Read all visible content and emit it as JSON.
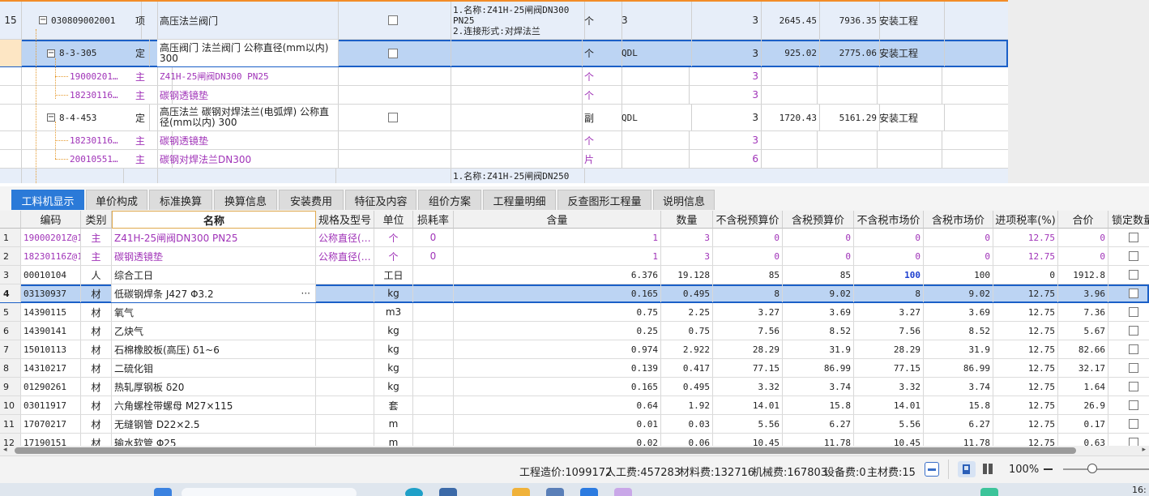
{
  "top_rows": [
    {
      "row_no": "15",
      "code": "030809002001",
      "type": "项",
      "name": "高压法兰阀门",
      "feature": "1.名称:Z41H-25闸阀DN300 PN25\n2.连接形式:对焊法兰",
      "unit": "个",
      "formula": "3",
      "qty": "3",
      "price": "2645.45",
      "total": "7936.35",
      "category": "安装工程"
    },
    {
      "row_no": "",
      "code": "8-3-305",
      "type": "定",
      "name": "高压阀门 法兰阀门 公称直径(mm以内) 300",
      "feature": "",
      "unit": "个",
      "formula": "QDL",
      "qty": "3",
      "price": "925.02",
      "total": "2775.06",
      "category": "安装工程"
    },
    {
      "code": "19000201…",
      "type": "主",
      "name": "Z41H-25闸阀DN300 PN25",
      "unit": "个",
      "qty": "3"
    },
    {
      "code": "18230116…",
      "type": "主",
      "name": "碳钢透镜垫",
      "unit": "个",
      "qty": "3"
    },
    {
      "code": "8-4-453",
      "type": "定",
      "name": "高压法兰 碳钢对焊法兰(电弧焊) 公称直径(mm以内) 300",
      "unit": "副",
      "formula": "QDL",
      "qty": "3",
      "price": "1720.43",
      "total": "5161.29",
      "category": "安装工程"
    },
    {
      "code": "18230116…",
      "type": "主",
      "name": "碳钢透镜垫",
      "unit": "个",
      "qty": "3"
    },
    {
      "code": "20010551…",
      "type": "主",
      "name": "碳钢对焊法兰DN300",
      "unit": "片",
      "qty": "6"
    },
    {
      "feature": "1.名称:Z41H-25闸阀DN250"
    }
  ],
  "tabs": [
    "工料机显示",
    "单价构成",
    "标准换算",
    "换算信息",
    "安装费用",
    "特征及内容",
    "组价方案",
    "工程量明细",
    "反查图形工程量",
    "说明信息"
  ],
  "bottom_headers": [
    "编码",
    "类别",
    "名称",
    "规格及型号",
    "单位",
    "损耗率",
    "含量",
    "数量",
    "不含税预算价",
    "含税预算价",
    "不含税市场价",
    "含税市场价",
    "进项税率(%)",
    "合价",
    "锁定数量"
  ],
  "bottom_rows": [
    {
      "n": "1",
      "code": "19000201Z@1",
      "type": "主",
      "name": "Z41H-25闸阀DN300 PN25",
      "spec": "公称直径(…",
      "unit": "个",
      "loss": "0",
      "content": "1",
      "qty": "3",
      "p1": "0",
      "p2": "0",
      "p3": "0",
      "p4": "0",
      "tax": "12.75",
      "sum": "0"
    },
    {
      "n": "2",
      "code": "18230116Z@1",
      "type": "主",
      "name": "碳钢透镜垫",
      "spec": "公称直径(…",
      "unit": "个",
      "loss": "0",
      "content": "1",
      "qty": "3",
      "p1": "0",
      "p2": "0",
      "p3": "0",
      "p4": "0",
      "tax": "12.75",
      "sum": "0"
    },
    {
      "n": "3",
      "code": "00010104",
      "type": "人",
      "name": "综合工日",
      "spec": "",
      "unit": "工日",
      "loss": "",
      "content": "6.376",
      "qty": "19.128",
      "p1": "85",
      "p2": "85",
      "p3": "100",
      "p4": "100",
      "tax": "0",
      "sum": "1912.8"
    },
    {
      "n": "4",
      "code": "03130937",
      "type": "材",
      "name": "低碳钢焊条 J427 Φ3.2",
      "spec": "",
      "unit": "kg",
      "loss": "",
      "content": "0.165",
      "qty": "0.495",
      "p1": "8",
      "p2": "9.02",
      "p3": "8",
      "p4": "9.02",
      "tax": "12.75",
      "sum": "3.96"
    },
    {
      "n": "5",
      "code": "14390115",
      "type": "材",
      "name": "氧气",
      "spec": "",
      "unit": "m3",
      "loss": "",
      "content": "0.75",
      "qty": "2.25",
      "p1": "3.27",
      "p2": "3.69",
      "p3": "3.27",
      "p4": "3.69",
      "tax": "12.75",
      "sum": "7.36"
    },
    {
      "n": "6",
      "code": "14390141",
      "type": "材",
      "name": "乙炔气",
      "spec": "",
      "unit": "kg",
      "loss": "",
      "content": "0.25",
      "qty": "0.75",
      "p1": "7.56",
      "p2": "8.52",
      "p3": "7.56",
      "p4": "8.52",
      "tax": "12.75",
      "sum": "5.67"
    },
    {
      "n": "7",
      "code": "15010113",
      "type": "材",
      "name": "石棉橡胶板(高压) δ1~6",
      "spec": "",
      "unit": "kg",
      "loss": "",
      "content": "0.974",
      "qty": "2.922",
      "p1": "28.29",
      "p2": "31.9",
      "p3": "28.29",
      "p4": "31.9",
      "tax": "12.75",
      "sum": "82.66"
    },
    {
      "n": "8",
      "code": "14310217",
      "type": "材",
      "name": "二硫化钼",
      "spec": "",
      "unit": "kg",
      "loss": "",
      "content": "0.139",
      "qty": "0.417",
      "p1": "77.15",
      "p2": "86.99",
      "p3": "77.15",
      "p4": "86.99",
      "tax": "12.75",
      "sum": "32.17"
    },
    {
      "n": "9",
      "code": "01290261",
      "type": "材",
      "name": "热轧厚钢板 δ20",
      "spec": "",
      "unit": "kg",
      "loss": "",
      "content": "0.165",
      "qty": "0.495",
      "p1": "3.32",
      "p2": "3.74",
      "p3": "3.32",
      "p4": "3.74",
      "tax": "12.75",
      "sum": "1.64"
    },
    {
      "n": "10",
      "code": "03011917",
      "type": "材",
      "name": "六角螺栓带螺母 M27×115",
      "spec": "",
      "unit": "套",
      "loss": "",
      "content": "0.64",
      "qty": "1.92",
      "p1": "14.01",
      "p2": "15.8",
      "p3": "14.01",
      "p4": "15.8",
      "tax": "12.75",
      "sum": "26.9"
    },
    {
      "n": "11",
      "code": "17070217",
      "type": "材",
      "name": "无缝钢管 D22×2.5",
      "spec": "",
      "unit": "m",
      "loss": "",
      "content": "0.01",
      "qty": "0.03",
      "p1": "5.56",
      "p2": "6.27",
      "p3": "5.56",
      "p4": "6.27",
      "tax": "12.75",
      "sum": "0.17"
    },
    {
      "n": "12",
      "code": "17190151",
      "type": "材",
      "name": "输水软管 Φ25",
      "spec": "",
      "unit": "m",
      "loss": "",
      "content": "0.02",
      "qty": "0.06",
      "p1": "10.45",
      "p2": "11.78",
      "p3": "10.45",
      "p4": "11.78",
      "tax": "12.75",
      "sum": "0.63"
    }
  ],
  "status": {
    "cost": "工程造价:1099172",
    "labor": "人工费:457283",
    "material": "材料费:132716",
    "machine": "机械费:167803",
    "equipment": "设备费:0",
    "main_material": "主材费:15",
    "zoom": "100%"
  },
  "taskbar": {
    "clock": "16:"
  },
  "colors": {
    "accent": "#2b7ad8",
    "selection": "#bcd4f3",
    "purple": "#a033b8",
    "orange": "#f28c28"
  }
}
